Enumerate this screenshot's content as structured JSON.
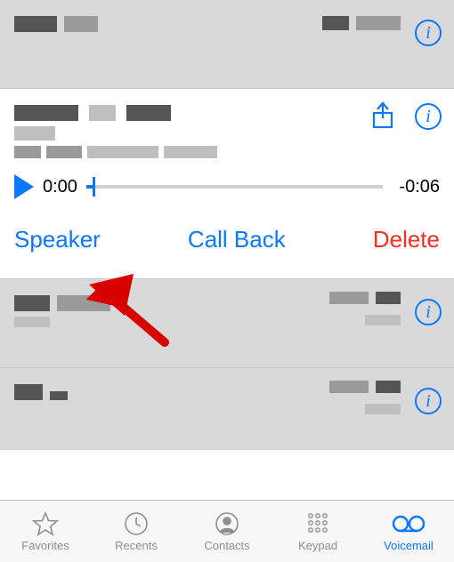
{
  "voicemails": [
    {
      "caller": "(redacted)",
      "date": "(redacted)",
      "expanded": false
    },
    {
      "caller": "(redacted)",
      "location": "(redacted)",
      "date": "(redacted)",
      "expanded": true,
      "playback": {
        "current_time": "0:00",
        "remaining_time": "-0:06"
      },
      "actions": {
        "speaker": "Speaker",
        "call_back": "Call Back",
        "delete": "Delete"
      }
    },
    {
      "caller": "(redacted)",
      "date": "(redacted)",
      "expanded": false
    },
    {
      "caller": "(redacted)",
      "date": "(redacted)",
      "expanded": false
    }
  ],
  "tabs": {
    "favorites": "Favorites",
    "recents": "Recents",
    "contacts": "Contacts",
    "keypad": "Keypad",
    "voicemail": "Voicemail"
  },
  "colors": {
    "accent": "#0b78ff",
    "destructive": "#ff2d1f"
  }
}
